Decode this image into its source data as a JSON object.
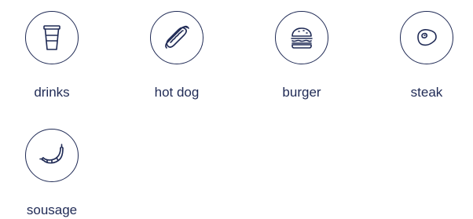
{
  "categories": [
    {
      "label": "drinks",
      "icon": "drink-cup-icon"
    },
    {
      "label": "hot dog",
      "icon": "hot-dog-icon"
    },
    {
      "label": "burger",
      "icon": "burger-icon"
    },
    {
      "label": "steak",
      "icon": "steak-icon"
    },
    {
      "label": "sousage",
      "icon": "sausage-icon"
    }
  ],
  "colors": {
    "accent": "#1f2a55"
  }
}
